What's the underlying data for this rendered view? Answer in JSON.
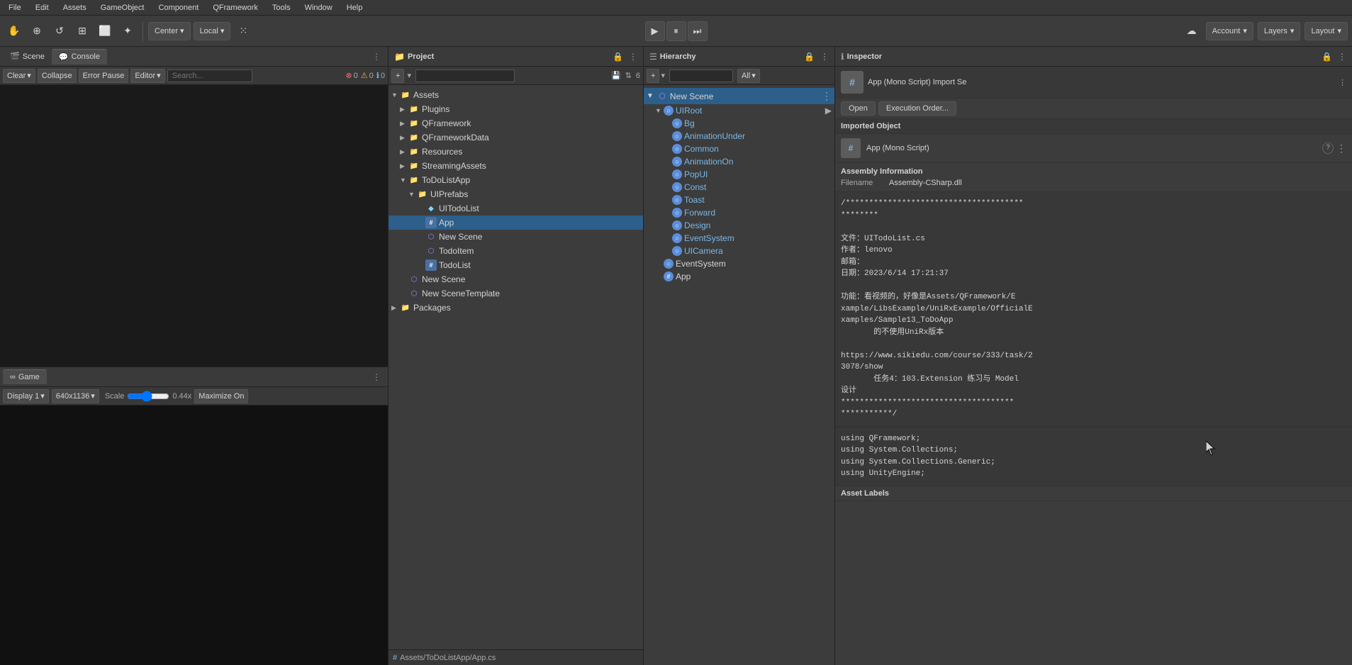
{
  "menubar": {
    "items": [
      "File",
      "Edit",
      "Assets",
      "GameObject",
      "Component",
      "QFramework",
      "Tools",
      "Window",
      "Help"
    ]
  },
  "toolbar": {
    "hand_tool": "✋",
    "move_tool": "⊕",
    "rotate_tool": "↺",
    "scale_tool": "⊞",
    "rect_tool": "⬜",
    "transform_tool": "✦",
    "custom_tool": "⁙",
    "center_label": "Center",
    "local_label": "Local",
    "layers_label": "Layers",
    "account_label": "Account",
    "layout_label": "Layout",
    "cloud_icon": "☁"
  },
  "scene_panel": {
    "tabs": [
      "Scene",
      "Console"
    ],
    "active_tab": "Console",
    "clear_label": "Clear",
    "collapse_label": "Collapse",
    "error_pause_label": "Error Pause",
    "editor_label": "Editor",
    "error_count": "0",
    "warn_count": "0",
    "info_count": "0"
  },
  "game_panel": {
    "title": "Game",
    "display_label": "Display 1",
    "resolution_label": "640x1136",
    "scale_label": "Scale",
    "scale_value": "0.44x",
    "maximize_label": "Maximize On"
  },
  "project_panel": {
    "title": "Project",
    "tree": [
      {
        "id": "assets",
        "label": "Assets",
        "indent": 0,
        "type": "folder",
        "expanded": true
      },
      {
        "id": "plugins",
        "label": "Plugins",
        "indent": 1,
        "type": "folder"
      },
      {
        "id": "qframework",
        "label": "QFramework",
        "indent": 1,
        "type": "folder"
      },
      {
        "id": "qframeworkdata",
        "label": "QFrameworkData",
        "indent": 1,
        "type": "folder"
      },
      {
        "id": "resources",
        "label": "Resources",
        "indent": 1,
        "type": "folder"
      },
      {
        "id": "streamingassets",
        "label": "StreamingAssets",
        "indent": 1,
        "type": "folder"
      },
      {
        "id": "todolistapp",
        "label": "ToDoListApp",
        "indent": 1,
        "type": "folder",
        "expanded": true
      },
      {
        "id": "uiprefabs",
        "label": "UIPrefabs",
        "indent": 2,
        "type": "folder",
        "expanded": true
      },
      {
        "id": "uitodolist",
        "label": "UITodoList",
        "indent": 3,
        "type": "prefab"
      },
      {
        "id": "app",
        "label": "App",
        "indent": 3,
        "type": "cs",
        "selected": true
      },
      {
        "id": "newscene1",
        "label": "New Scene",
        "indent": 3,
        "type": "scene"
      },
      {
        "id": "todoitem",
        "label": "TodoItem",
        "indent": 3,
        "type": "scene"
      },
      {
        "id": "todolist",
        "label": "TodoList",
        "indent": 3,
        "type": "cs"
      },
      {
        "id": "newscene2",
        "label": "New Scene",
        "indent": 1,
        "type": "scene"
      },
      {
        "id": "newscenetemplate",
        "label": "New SceneTemplate",
        "indent": 1,
        "type": "scene"
      },
      {
        "id": "packages",
        "label": "Packages",
        "indent": 0,
        "type": "folder"
      }
    ],
    "footer": "Assets/ToDoListApp/App.cs"
  },
  "hierarchy_panel": {
    "title": "Hierarchy",
    "all_label": "All",
    "scene": {
      "name": "New Scene",
      "children": [
        {
          "id": "uiroot",
          "label": "UIRoot",
          "indent": 2,
          "expanded": true
        },
        {
          "id": "bg",
          "label": "Bg",
          "indent": 3
        },
        {
          "id": "animationunder",
          "label": "AnimationUnder",
          "indent": 3
        },
        {
          "id": "common",
          "label": "Common",
          "indent": 3
        },
        {
          "id": "animationon",
          "label": "AnimationOn",
          "indent": 3
        },
        {
          "id": "popui",
          "label": "PopUI",
          "indent": 3
        },
        {
          "id": "const",
          "label": "Const",
          "indent": 3
        },
        {
          "id": "toast",
          "label": "Toast",
          "indent": 3
        },
        {
          "id": "forward",
          "label": "Forward",
          "indent": 3
        },
        {
          "id": "design",
          "label": "Design",
          "indent": 3
        },
        {
          "id": "eventsystem2",
          "label": "EventSystem",
          "indent": 3
        },
        {
          "id": "uicamera",
          "label": "UICamera",
          "indent": 3
        }
      ]
    },
    "other_items": [
      {
        "id": "eventsystem",
        "label": "EventSystem",
        "indent": 1
      },
      {
        "id": "app_h",
        "label": "App",
        "indent": 1
      }
    ]
  },
  "inspector_panel": {
    "title": "Inspector",
    "script_title": "App (Mono Script) Import Se",
    "open_label": "Open",
    "execution_order_label": "Execution Order...",
    "imported_object_label": "Imported Object",
    "imported_name": "App (Mono Script)",
    "assembly_info_label": "Assembly Information",
    "filename_label": "Filename",
    "filename_value": "Assembly-CSharp.dll",
    "code_comment": "/**************************************\n********\n\n文件：UITodoList.cs\n作者：lenovo\n邮箱：\n日期：2023/6/14 17:21:37\n\n功能：看视频的，好像是Assets/QFramework/E\nxample/LibsExample/UniRxExample/OfficialE\nxamples/Sample13_ToDoApp\n       的不使用UniRx版本\n\nhttps://www.sikiedu.com/course/333/task/2\n3078/show\n       任务4：103.Extension 练习与 Model\n设计\n*************************************\n***********/",
    "code_section": "using QFramework;\nusing System.Collections;\nusing System.Collections.Generic;\nusing UnityEngine;",
    "asset_labels": "Asset Labels"
  }
}
